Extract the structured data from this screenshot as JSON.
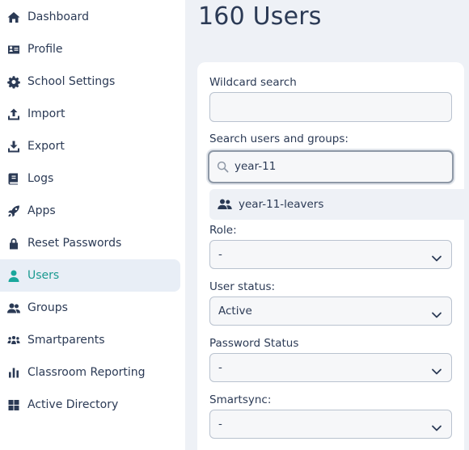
{
  "sidebar": {
    "items": [
      {
        "label": "Dashboard",
        "icon": "home-icon",
        "active": false
      },
      {
        "label": "Profile",
        "icon": "id-card-icon",
        "active": false
      },
      {
        "label": "School Settings",
        "icon": "gear-icon",
        "active": false
      },
      {
        "label": "Import",
        "icon": "upload-icon",
        "active": false
      },
      {
        "label": "Export",
        "icon": "download-icon",
        "active": false
      },
      {
        "label": "Logs",
        "icon": "book-icon",
        "active": false
      },
      {
        "label": "Apps",
        "icon": "rocket-icon",
        "active": false
      },
      {
        "label": "Reset Passwords",
        "icon": "lock-icon",
        "active": false
      },
      {
        "label": "Users",
        "icon": "user-icon",
        "active": true
      },
      {
        "label": "Groups",
        "icon": "users-icon",
        "active": false
      },
      {
        "label": "Smartparents",
        "icon": "people-group-icon",
        "active": false
      },
      {
        "label": "Classroom Reporting",
        "icon": "bar-chart-icon",
        "active": false
      },
      {
        "label": "Active Directory",
        "icon": "windows-icon",
        "active": false
      }
    ]
  },
  "main": {
    "title": "160 Users",
    "wildcard": {
      "label": "Wildcard search",
      "value": ""
    },
    "search": {
      "label": "Search users and groups:",
      "value": "year-11"
    },
    "suggestion": {
      "label": "year-11-leavers",
      "icon": "users-icon"
    },
    "role": {
      "label": "Role:",
      "value": "-"
    },
    "user_status": {
      "label": "User status:",
      "value": "Active"
    },
    "password_status": {
      "label": "Password Status",
      "value": "-"
    },
    "smartsync": {
      "label": "Smartsync:",
      "value": "-"
    }
  },
  "colors": {
    "accent": "#1aa79c",
    "text": "#2b3a55",
    "background": "#eef1f6"
  }
}
